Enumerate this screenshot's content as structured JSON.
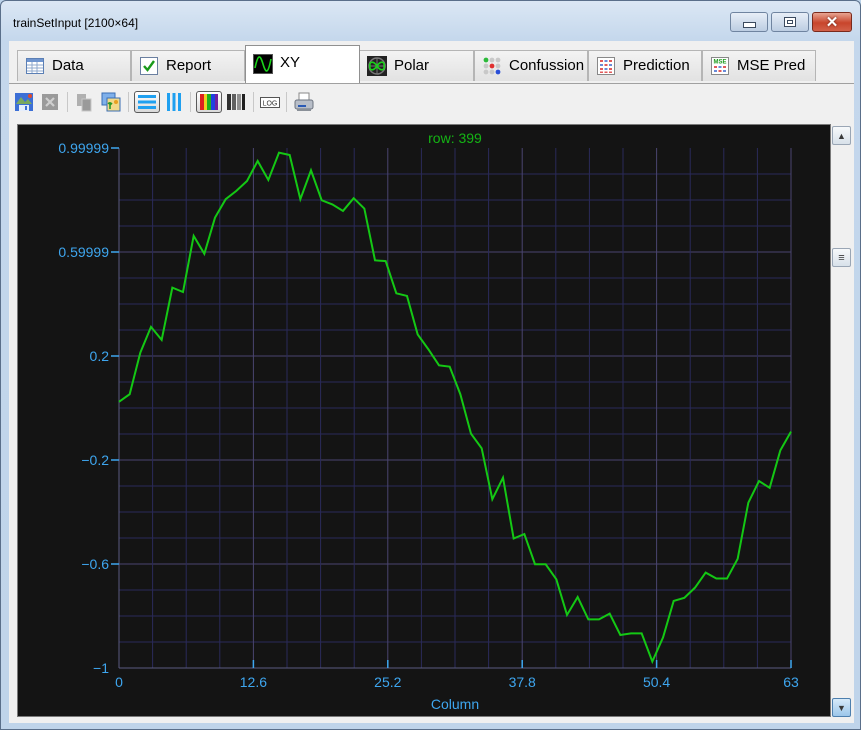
{
  "window": {
    "title": "trainSetInput [2100×64]",
    "controls": {
      "minimize": "minimize",
      "maximize": "maximize",
      "close": "close"
    }
  },
  "tabs": [
    {
      "label": "Data",
      "icon": "table-icon",
      "active": false
    },
    {
      "label": "Report",
      "icon": "checkmark-icon",
      "active": false
    },
    {
      "label": "XY",
      "icon": "sine-wave-icon",
      "active": true
    },
    {
      "label": "Polar",
      "icon": "polar-plot-icon",
      "active": false
    },
    {
      "label": "Confussion",
      "icon": "confusion-matrix-icon",
      "active": false
    },
    {
      "label": "Prediction",
      "icon": "prediction-grid-icon",
      "active": false
    },
    {
      "label": "MSE Pred",
      "icon": "mse-grid-icon",
      "active": false
    }
  ],
  "toolbar": [
    {
      "name": "save-image",
      "icon": "save-image-icon",
      "enabled": true
    },
    {
      "name": "export-excel",
      "icon": "excel-icon",
      "enabled": false
    },
    {
      "name": "copy",
      "icon": "copy-icon",
      "enabled": false
    },
    {
      "name": "copy-image",
      "icon": "copy-image-icon",
      "enabled": true
    },
    {
      "name": "rows-mode",
      "icon": "horizontal-lines-icon",
      "pressed": true
    },
    {
      "name": "columns-mode",
      "icon": "vertical-lines-icon",
      "pressed": false
    },
    {
      "name": "color-palette",
      "icon": "color-bars-icon",
      "pressed": true
    },
    {
      "name": "grayscale-palette",
      "icon": "gray-bars-icon",
      "pressed": false
    },
    {
      "name": "log-scale",
      "icon": "log-icon",
      "pressed": false
    },
    {
      "name": "print",
      "icon": "printer-icon",
      "enabled": true
    }
  ],
  "colors": {
    "plot_background": "#141414",
    "grid_major": "#4a4570",
    "grid_minor": "#2a2a5a",
    "axis_text": "#3ea6ef",
    "series_line": "#14c814",
    "title_text": "#14b414"
  },
  "chart_data": {
    "type": "line",
    "title": "row: 399",
    "xlabel": "Column",
    "ylabel": "",
    "xlim": [
      0,
      63
    ],
    "ylim": [
      -1,
      0.99999
    ],
    "xticks": [
      0,
      12.6,
      25.2,
      37.8,
      50.4,
      63
    ],
    "xtick_labels": [
      "0",
      "12.6",
      "25.2",
      "37.8",
      "50.4",
      "63"
    ],
    "yticks": [
      0.99999,
      0.59999,
      0.2,
      -0.2,
      -0.6,
      -1
    ],
    "ytick_labels": [
      "0.99999",
      "0.59999",
      "0.2",
      "−0.2",
      "−0.6",
      "−1"
    ],
    "grid": true,
    "legend": "none",
    "series": [
      {
        "name": "row 399",
        "x": [
          0,
          1,
          2,
          3,
          4,
          5,
          6,
          7,
          8,
          9,
          10,
          11,
          12,
          13,
          14,
          15,
          16,
          17,
          18,
          19,
          20,
          21,
          22,
          23,
          24,
          25,
          26,
          27,
          28,
          29,
          30,
          31,
          32,
          33,
          34,
          35,
          36,
          37,
          38,
          39,
          40,
          41,
          42,
          43,
          44,
          45,
          46,
          47,
          48,
          49,
          50,
          51,
          52,
          53,
          54,
          55,
          56,
          57,
          58,
          59,
          60,
          61,
          62,
          63
        ],
        "values": [
          0.024,
          0.053,
          0.213,
          0.312,
          0.262,
          0.463,
          0.446,
          0.662,
          0.593,
          0.732,
          0.803,
          0.835,
          0.873,
          0.95,
          0.877,
          0.982,
          0.973,
          0.803,
          0.914,
          0.799,
          0.783,
          0.758,
          0.807,
          0.767,
          0.568,
          0.565,
          0.441,
          0.431,
          0.283,
          0.226,
          0.164,
          0.159,
          0.053,
          -0.099,
          -0.155,
          -0.351,
          -0.268,
          -0.502,
          -0.485,
          -0.601,
          -0.601,
          -0.659,
          -0.796,
          -0.727,
          -0.813,
          -0.813,
          -0.791,
          -0.873,
          -0.867,
          -0.867,
          -0.975,
          -0.883,
          -0.742,
          -0.73,
          -0.691,
          -0.633,
          -0.656,
          -0.656,
          -0.58,
          -0.364,
          -0.281,
          -0.307,
          -0.163,
          -0.091
        ]
      }
    ]
  }
}
